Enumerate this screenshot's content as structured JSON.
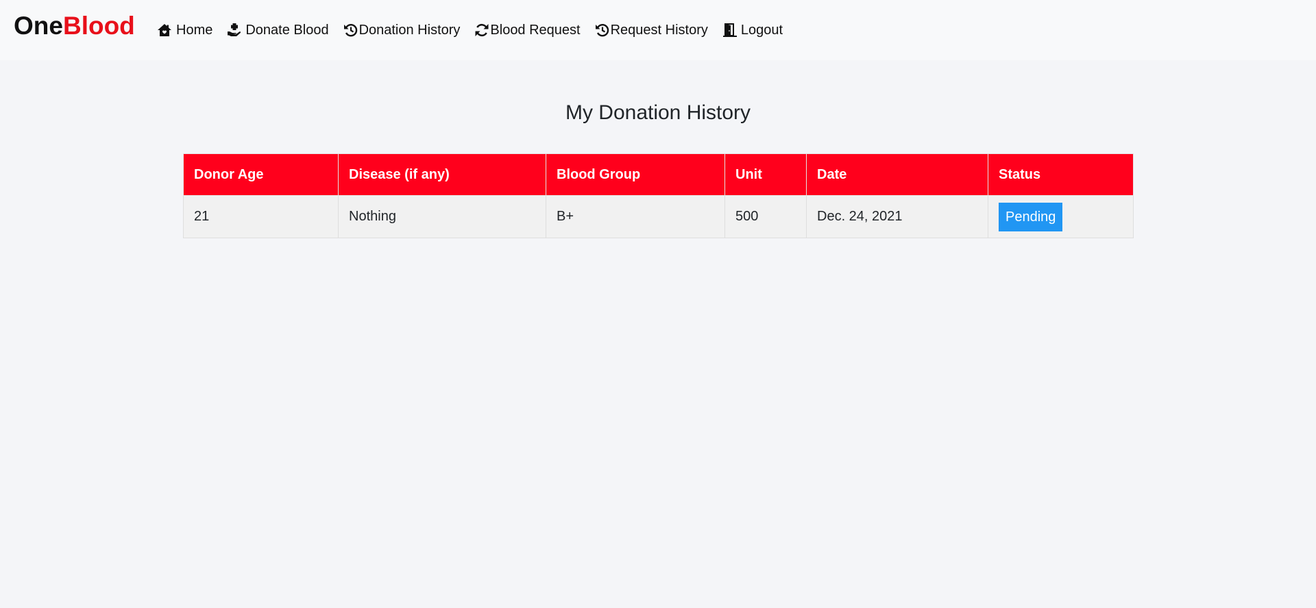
{
  "brand": {
    "part1": "One",
    "part2": "Blood"
  },
  "nav": {
    "items": [
      {
        "label": "Home",
        "icon": "home-icon"
      },
      {
        "label": "Donate Blood",
        "icon": "hand-holding-icon"
      },
      {
        "label": "Donation History",
        "icon": "history-icon"
      },
      {
        "label": "Blood Request",
        "icon": "sync-icon"
      },
      {
        "label": "Request History",
        "icon": "history-icon"
      },
      {
        "label": "Logout",
        "icon": "door-exit-icon"
      }
    ]
  },
  "page": {
    "title": "My Donation History"
  },
  "table": {
    "headers": [
      "Donor Age",
      "Disease (if any)",
      "Blood Group",
      "Unit",
      "Date",
      "Status"
    ],
    "rows": [
      {
        "age": "21",
        "disease": "Nothing",
        "blood_group": "B+",
        "unit": "500",
        "date": "Dec. 24, 2021",
        "status": "Pending"
      }
    ]
  },
  "colors": {
    "brand_accent": "#e8101a",
    "table_header": "#ff001c",
    "status_pending": "#2196f3"
  }
}
